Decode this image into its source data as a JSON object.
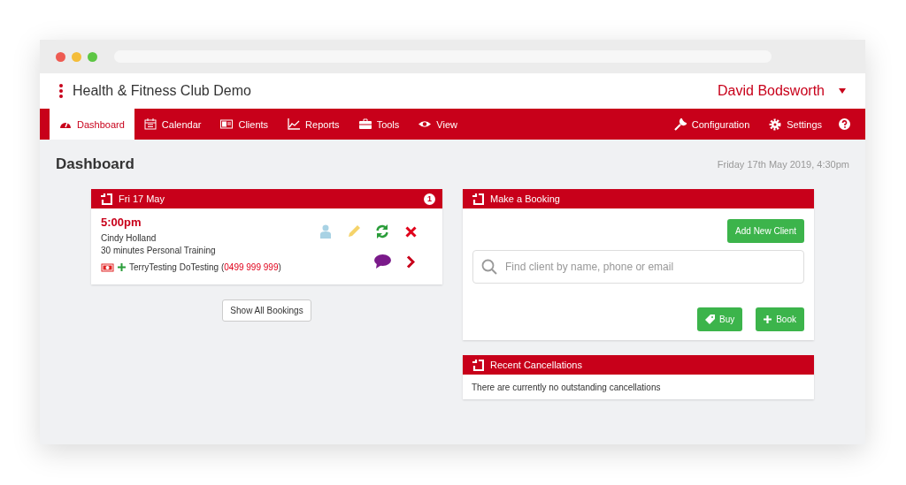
{
  "app": {
    "title": "Health & Fitness Club Demo",
    "user": "David Bodsworth"
  },
  "nav": [
    {
      "label": "Dashboard",
      "selected": true
    },
    {
      "label": "Calendar",
      "selected": false
    },
    {
      "label": "Clients",
      "selected": false
    },
    {
      "label": "Reports",
      "selected": false
    },
    {
      "label": "Tools",
      "selected": false
    },
    {
      "label": "View",
      "selected": false
    }
  ],
  "nav_right": [
    {
      "label": "Configuration"
    },
    {
      "label": "Settings"
    }
  ],
  "page": {
    "title": "Dashboard",
    "date": "Friday 17th May 2019, 4:30pm"
  },
  "bookings_panel": {
    "title": "Fri 17 May",
    "count": "1",
    "booking": {
      "time": "5:00pm",
      "client": "Cindy Holland",
      "service": "30 minutes Personal Training",
      "contact": "TerryTesting DoTesting (",
      "phone": "0499 999 999",
      "phone_close": ")"
    },
    "show_all": "Show All Bookings"
  },
  "make_booking": {
    "title": "Make a Booking",
    "add_client": "Add New Client",
    "search": {
      "placeholder": "Find client by name, phone or email"
    },
    "buy": "Buy",
    "book": "Book"
  },
  "cancellations": {
    "title": "Recent Cancellations",
    "message": "There are currently no outstanding cancellations"
  }
}
